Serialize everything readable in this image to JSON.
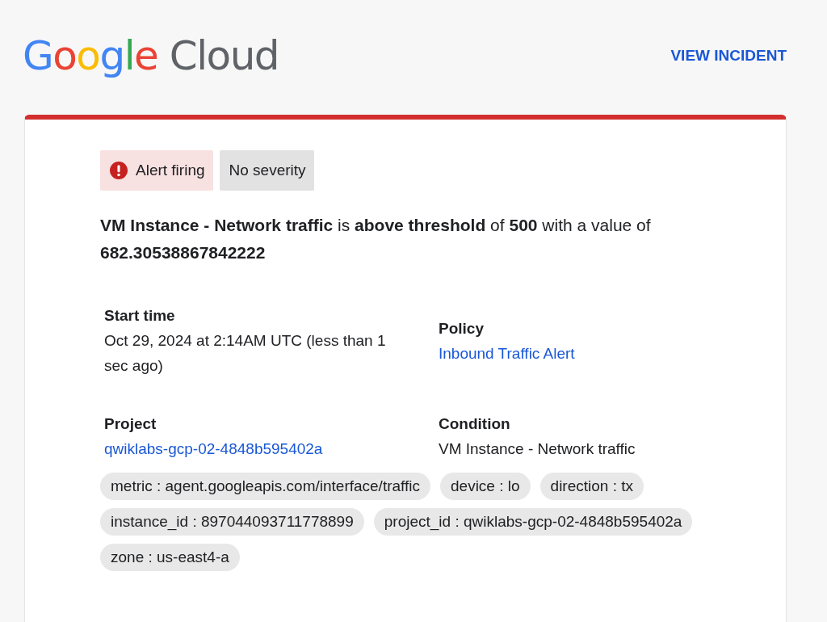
{
  "header": {
    "logo": {
      "word_1": "Google",
      "word_2": "Cloud"
    },
    "action": "VIEW INCIDENT"
  },
  "card": {
    "status": {
      "kind": "firing",
      "label": "Alert firing"
    },
    "severity": "No severity",
    "summary": "**VM Instance - Network traffic** is **above threshold** of **500** with a value of **682.30538867842222**",
    "details": [
      {
        "label": "Start time",
        "value": "Oct 29, 2024 at 2:14AM UTC (less than 1 sec ago)",
        "kind": "text"
      },
      {
        "label": "Policy",
        "value": "Inbound Traffic Alert",
        "kind": "link"
      },
      {
        "label": "Project",
        "value": "qwiklabs-gcp-02-4848b595402a",
        "kind": "link"
      },
      {
        "label": "Condition",
        "value": "VM Instance - Network traffic",
        "kind": "text"
      }
    ],
    "labels": [
      "metric : agent.googleapis.com/interface/traffic",
      "device : lo",
      "direction : tx",
      "instance_id : 897044093711778899",
      "project_id : qwiklabs-gcp-02-4848b595402a",
      "zone : us-east4-a"
    ]
  }
}
